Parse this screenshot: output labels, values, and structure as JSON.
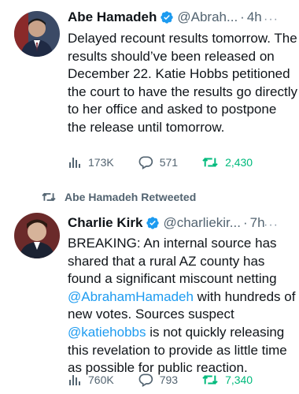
{
  "tweets": [
    {
      "author": "Abe Hamadeh",
      "handle": "@Abrah...",
      "time": "4h",
      "text": "Delayed recount results tomorrow. The results should’ve been released on December 22. Katie Hobbs petitioned the court to have the results go directly to her office and asked to postpone the release until tomorrow.",
      "views": "173K",
      "replies": "571",
      "retweets": "2,430"
    },
    {
      "retweeted_by": "Abe Hamadeh Retweeted",
      "author": "Charlie Kirk",
      "handle": "@charliekir...",
      "time": "7h",
      "text_parts": [
        "BREAKING: An internal source has shared that a rural AZ county has found a significant miscount netting ",
        "@AbrahamHamadeh",
        " with hundreds of new votes. Sources suspect ",
        "@katiehobbs",
        " is not quickly releasing this revelation to provide as little time as possible for public reaction."
      ],
      "views": "760K",
      "replies": "793",
      "retweets": "7,340"
    }
  ],
  "ui": {
    "dot": "·",
    "more": "···"
  },
  "colors": {
    "link": "#1d9bf0",
    "retweet": "#00ba7c",
    "muted": "#536471",
    "verified": "#1d9bf0"
  },
  "icons": [
    "verified-badge-icon",
    "views-icon",
    "reply-icon",
    "retweet-icon",
    "more-icon"
  ]
}
